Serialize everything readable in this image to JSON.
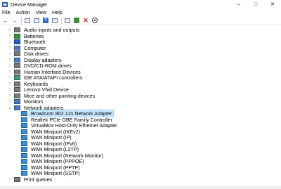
{
  "window": {
    "title": "Device Manager",
    "controls": [
      "–",
      "□",
      "✕"
    ]
  },
  "menu": [
    "File",
    "Action",
    "View",
    "Help"
  ],
  "toolbar": {
    "icons": [
      "back-arrow-icon",
      "forward-arrow-icon",
      "properties-icon",
      "show-hidden-icon",
      "help-icon",
      "update-driver-icon",
      "scan-hardware-icon",
      "uninstall-icon",
      "disable-icon"
    ]
  },
  "tree": {
    "categories": [
      {
        "label": "Audio inputs and outputs",
        "icon": "speaker-icon",
        "color": "#7a7a7a"
      },
      {
        "label": "Batteries",
        "icon": "battery-icon",
        "color": "#3e8e3e"
      },
      {
        "label": "Bluetooth",
        "icon": "bluetooth-icon",
        "color": "#1f5fbf"
      },
      {
        "label": "Computer",
        "icon": "computer-icon",
        "color": "#4a7ab8"
      },
      {
        "label": "Disk drives",
        "icon": "disk-icon",
        "color": "#7a7a7a"
      },
      {
        "label": "Display adapters",
        "icon": "display-icon",
        "color": "#4a7ab8"
      },
      {
        "label": "DVD/CD-ROM drives",
        "icon": "dvd-icon",
        "color": "#7a7a7a"
      },
      {
        "label": "Human Interface Devices",
        "icon": "hid-icon",
        "color": "#7a7a7a"
      },
      {
        "label": "IDE ATA/ATAPI controllers",
        "icon": "ide-icon",
        "color": "#4a9a7a"
      },
      {
        "label": "Keyboards",
        "icon": "keyboard-icon",
        "color": "#7a7a7a"
      },
      {
        "label": "Lenovo Vhid Device",
        "icon": "device-icon",
        "color": "#7a7a7a"
      },
      {
        "label": "Mice and other pointing devices",
        "icon": "mouse-icon",
        "color": "#7a7a7a"
      },
      {
        "label": "Monitors",
        "icon": "monitor-icon",
        "color": "#4a7ab8"
      },
      {
        "label": "Network adapters",
        "icon": "network-icon",
        "color": "#4a7ab8"
      }
    ],
    "network_children": [
      {
        "label": "Broadcom 802.11n Network Adapter",
        "selected": true
      },
      {
        "label": "Realtek PCIe GBE Family Controller"
      },
      {
        "label": "VirtualBox Host-Only Ethernet Adapter"
      },
      {
        "label": "WAN Miniport (IKEv2)"
      },
      {
        "label": "WAN Miniport (IP)"
      },
      {
        "label": "WAN Miniport (IPv6)"
      },
      {
        "label": "WAN Miniport (L2TP)"
      },
      {
        "label": "WAN Miniport (Network Monitor)"
      },
      {
        "label": "WAN Miniport (PPPOE)"
      },
      {
        "label": "WAN Miniport (PPTP)"
      },
      {
        "label": "WAN Miniport (SSTP)"
      }
    ],
    "after": [
      {
        "label": "Print queues",
        "icon": "printer-icon",
        "color": "#7a7a7a"
      }
    ]
  }
}
